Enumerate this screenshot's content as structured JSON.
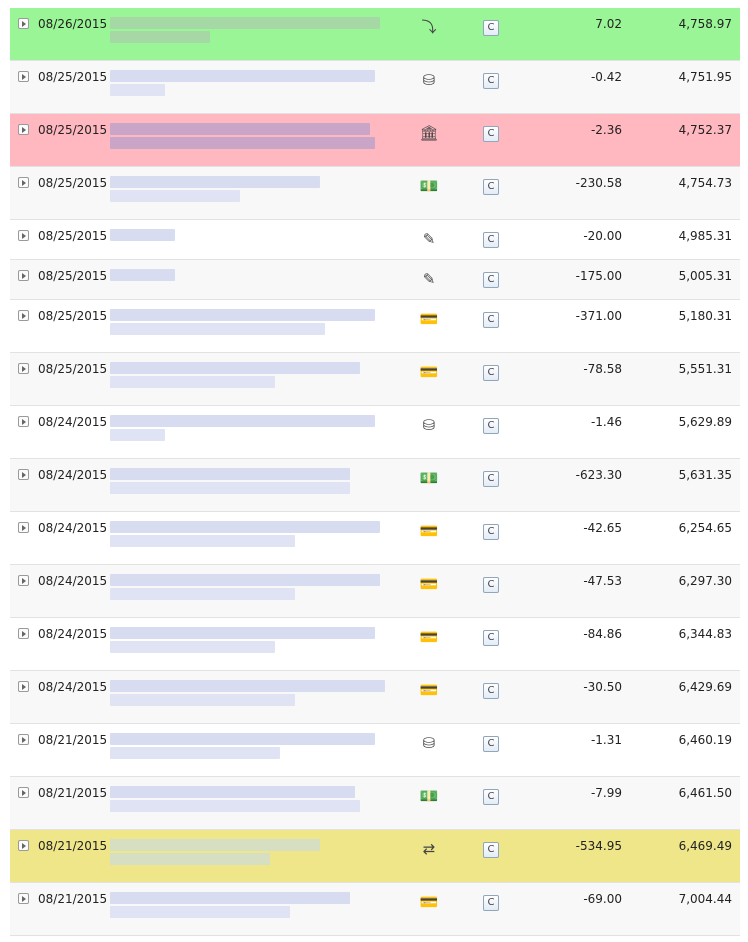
{
  "colors": {
    "deposit_highlight": "#99f595",
    "fee_highlight": "#ffb7c0",
    "transfer_highlight": "#efe68a",
    "row_stripe": "#f8f8f8"
  },
  "clear_label": "C",
  "transactions": [
    {
      "date": "08/26/2015",
      "icon": "deposit-arrow-icon",
      "glyph": "⤵",
      "amount": "7.02",
      "balance": "4,758.97",
      "highlight": "green"
    },
    {
      "date": "08/25/2015",
      "icon": "coins-icon",
      "glyph": "⛁",
      "amount": "-0.42",
      "balance": "4,751.95",
      "highlight": "stripe"
    },
    {
      "date": "08/25/2015",
      "icon": "bank-icon",
      "glyph": "🏛",
      "amount": "-2.36",
      "balance": "4,752.37",
      "highlight": "pink"
    },
    {
      "date": "08/25/2015",
      "icon": "cash-icon",
      "glyph": "💵",
      "amount": "-230.58",
      "balance": "4,754.73",
      "highlight": "stripe"
    },
    {
      "date": "08/25/2015",
      "icon": "check-icon",
      "glyph": "✎",
      "amount": "-20.00",
      "balance": "4,985.31",
      "highlight": "plain"
    },
    {
      "date": "08/25/2015",
      "icon": "check-icon",
      "glyph": "✎",
      "amount": "-175.00",
      "balance": "5,005.31",
      "highlight": "stripe"
    },
    {
      "date": "08/25/2015",
      "icon": "credit-card-icon",
      "glyph": "💳",
      "amount": "-371.00",
      "balance": "5,180.31",
      "highlight": "plain"
    },
    {
      "date": "08/25/2015",
      "icon": "credit-card-icon",
      "glyph": "💳",
      "amount": "-78.58",
      "balance": "5,551.31",
      "highlight": "stripe"
    },
    {
      "date": "08/24/2015",
      "icon": "coins-icon",
      "glyph": "⛁",
      "amount": "-1.46",
      "balance": "5,629.89",
      "highlight": "plain"
    },
    {
      "date": "08/24/2015",
      "icon": "cash-icon",
      "glyph": "💵",
      "amount": "-623.30",
      "balance": "5,631.35",
      "highlight": "stripe"
    },
    {
      "date": "08/24/2015",
      "icon": "credit-card-icon",
      "glyph": "💳",
      "amount": "-42.65",
      "balance": "6,254.65",
      "highlight": "plain"
    },
    {
      "date": "08/24/2015",
      "icon": "credit-card-icon",
      "glyph": "💳",
      "amount": "-47.53",
      "balance": "6,297.30",
      "highlight": "stripe"
    },
    {
      "date": "08/24/2015",
      "icon": "credit-card-icon",
      "glyph": "💳",
      "amount": "-84.86",
      "balance": "6,344.83",
      "highlight": "plain"
    },
    {
      "date": "08/24/2015",
      "icon": "credit-card-icon",
      "glyph": "💳",
      "amount": "-30.50",
      "balance": "6,429.69",
      "highlight": "stripe"
    },
    {
      "date": "08/21/2015",
      "icon": "coins-icon",
      "glyph": "⛁",
      "amount": "-1.31",
      "balance": "6,460.19",
      "highlight": "plain"
    },
    {
      "date": "08/21/2015",
      "icon": "cash-icon",
      "glyph": "💵",
      "amount": "-7.99",
      "balance": "6,461.50",
      "highlight": "stripe"
    },
    {
      "date": "08/21/2015",
      "icon": "transfer-arrows-icon",
      "glyph": "⇄",
      "amount": "-534.95",
      "balance": "6,469.49",
      "highlight": "yellow"
    },
    {
      "date": "08/21/2015",
      "icon": "credit-card-icon",
      "glyph": "💳",
      "amount": "-69.00",
      "balance": "7,004.44",
      "highlight": "stripe"
    }
  ]
}
